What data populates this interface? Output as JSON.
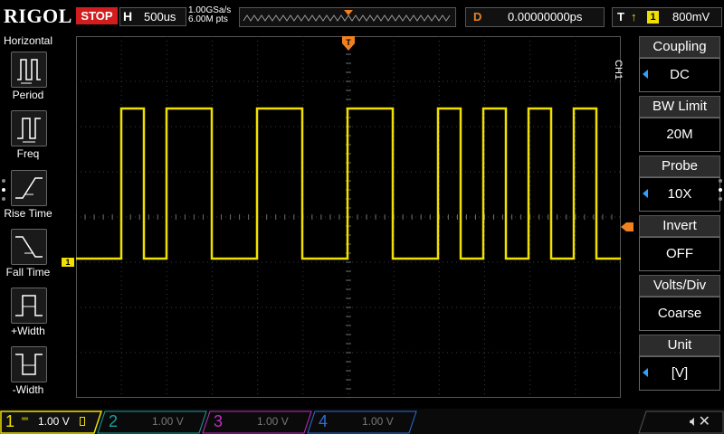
{
  "top": {
    "brand": "RIGOL",
    "run_state": "STOP",
    "timebase_label": "H",
    "timebase": "500us",
    "sample_rate": "1.00GSa/s",
    "mem_depth": "6.00M pts",
    "delay_label": "D",
    "delay": "0.00000000ps",
    "trigger_label": "T",
    "trigger_source": "1",
    "trigger_level": "800mV"
  },
  "left_menu": {
    "title": "Horizontal",
    "items": [
      {
        "label": "Period"
      },
      {
        "label": "Freq"
      },
      {
        "label": "Rise Time"
      },
      {
        "label": "Fall Time"
      },
      {
        "label": "+Width"
      },
      {
        "label": "-Width"
      }
    ]
  },
  "right_menu": {
    "channel": "CH1",
    "items": [
      {
        "title": "Coupling",
        "value": "DC"
      },
      {
        "title": "BW Limit",
        "value": "20M"
      },
      {
        "title": "Probe",
        "value": "10X"
      },
      {
        "title": "Invert",
        "value": "OFF"
      },
      {
        "title": "Volts/Div",
        "value": "Coarse"
      },
      {
        "title": "Unit",
        "value": "[V]"
      }
    ]
  },
  "channels": [
    {
      "num": "1",
      "scale": "1.00 V",
      "color": "#f0e000"
    },
    {
      "num": "2",
      "scale": "1.00 V",
      "color": "#19a0a0"
    },
    {
      "num": "3",
      "scale": "1.00 V",
      "color": "#c02ec0"
    },
    {
      "num": "4",
      "scale": "1.00 V",
      "color": "#2e6fd8"
    }
  ],
  "markers": {
    "ch1_ground": "1"
  },
  "colors": {
    "trace": "#f0e000",
    "trigger": "#f08020",
    "accent_blue": "#2ea0ff",
    "grid": "#3a3a3a"
  }
}
